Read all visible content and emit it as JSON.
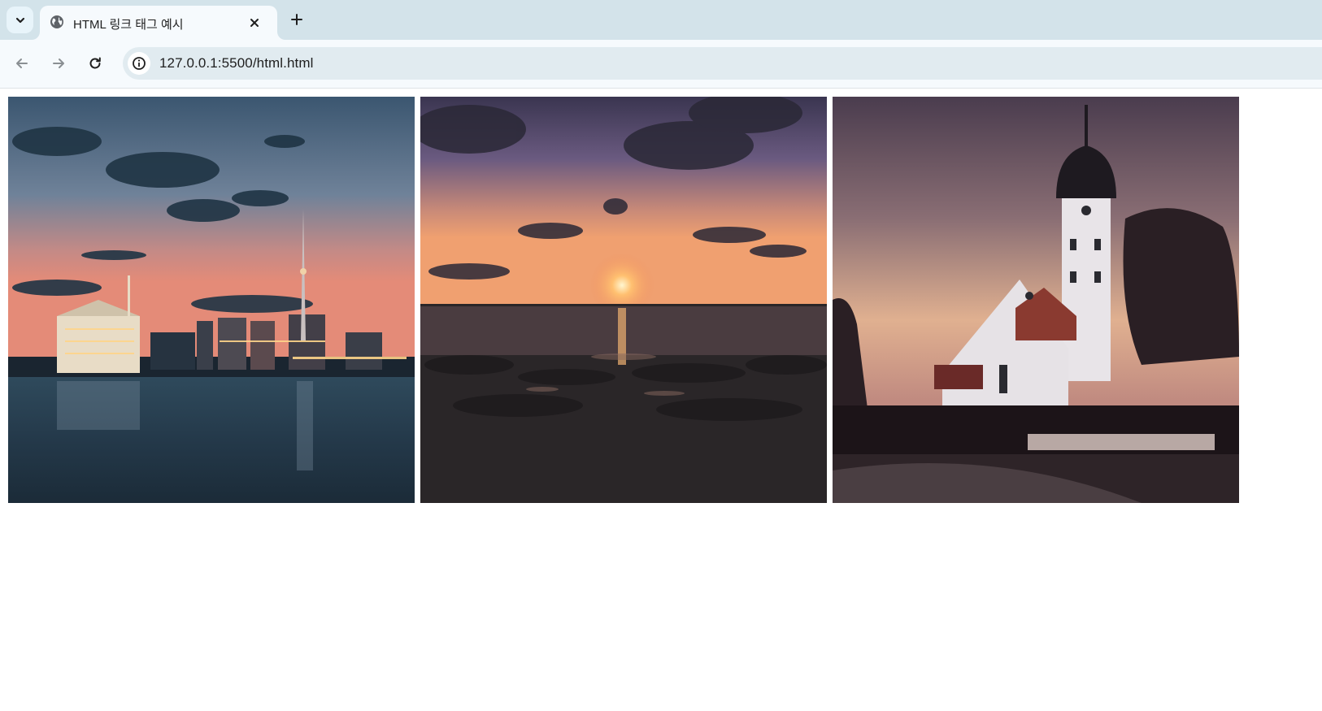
{
  "browser": {
    "tab": {
      "title": "HTML 링크 태그 예시"
    },
    "address_bar": {
      "url": "127.0.0.1:5500/html.html"
    }
  },
  "page": {
    "images": [
      {
        "subject": "city skyline with TV tower at dusk over river"
      },
      {
        "subject": "sunset over water with dramatic clouds"
      },
      {
        "subject": "church with onion dome tower at sunset"
      }
    ]
  },
  "colors": {
    "tabstrip_bg": "#d3e3ea",
    "toolbar_bg": "#f6fafd",
    "omnibox_bg": "#e1ebf0",
    "icon": "#1f1f1f",
    "icon_disabled": "#8a8f93"
  }
}
